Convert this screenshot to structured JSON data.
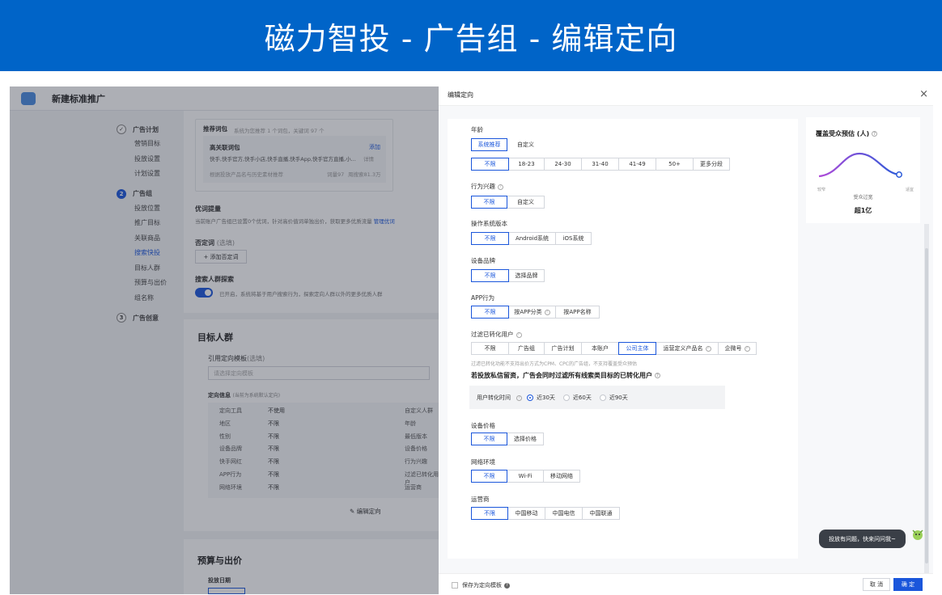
{
  "banner_title": "磁力智投 - 广告组 - 编辑定向",
  "bg": {
    "app_title": "新建标准推广",
    "steps": [
      {
        "num": "✓",
        "label": "广告计划",
        "subs": [
          "营销目标",
          "投放设置",
          "计划设置"
        ]
      },
      {
        "num": "2",
        "label": "广告组",
        "subs": [
          "投放位置",
          "推广目标",
          "关联商品",
          "搜索快投",
          "目标人群",
          "预算与出价",
          "组名称"
        ]
      },
      {
        "num": "3",
        "label": "广告创意",
        "subs": []
      }
    ],
    "recommend_title": "推荐词包",
    "recommend_note": "系统为您推荐 1 个词包，关键词 97 个",
    "pack_title": "高关联词包",
    "pack_add": "添加",
    "pack_words": "快手,快手官方,快手小店,快手直播,快手App,快手官方直播,小...",
    "pack_detail": "详情",
    "pack_note": "根据投放产品名与历史素材推荐",
    "pack_count": "词量97",
    "pack_volume": "周搜索81.3万",
    "opt_title": "优词提量",
    "opt_desc": "当前账户广告组已设置0个优词，针对高价值词单独出价，获取更多优质流量",
    "opt_link": "管理优词",
    "neg_title": "否定词",
    "neg_optional": "(选填)",
    "neg_add": "+ 添加否定词",
    "explore_title": "搜索人群探索",
    "explore_desc": "已开启，系统将基于用户搜索行为，探索定向人群以外的更多优质人群",
    "audience_title": "目标人群",
    "tpl_label": "引用定向模板",
    "tpl_optional": "(选填)",
    "tpl_placeholder": "请选择定向模板",
    "info_title": "定向信息",
    "info_note": "(当前为系统默认定向)",
    "info_rows": [
      [
        "定向工具",
        "不使用",
        "自定义人群"
      ],
      [
        "地区",
        "不限",
        "年龄"
      ],
      [
        "性别",
        "不限",
        "最低版本"
      ],
      [
        "设备品牌",
        "不限",
        "设备价格"
      ],
      [
        "快手网红",
        "不限",
        "行为兴趣"
      ],
      [
        "APP行为",
        "不限",
        "过滤已转化用户"
      ],
      [
        "网络环境",
        "不限",
        "运营商"
      ]
    ],
    "edit_targeting": "✎ 编辑定向",
    "budget_title": "预算与出价",
    "schedule_label": "投放日期"
  },
  "drawer": {
    "title": "编辑定向",
    "close": "×",
    "age": {
      "label": "年龄",
      "modes": [
        "系统推荐",
        "自定义"
      ],
      "options": [
        "不限",
        "18-23",
        "24-30",
        "31-40",
        "41-49",
        "50+",
        "更多分段"
      ]
    },
    "interest": {
      "label": "行为兴趣",
      "options": [
        "不限",
        "自定义"
      ]
    },
    "os": {
      "label": "操作系统版本",
      "options": [
        "不限",
        "Android系统",
        "iOS系统"
      ]
    },
    "brand": {
      "label": "设备品牌",
      "options": [
        "不限",
        "选择品牌"
      ]
    },
    "app": {
      "label": "APP行为",
      "options": [
        "不限",
        "按APP分类",
        "按APP名称"
      ]
    },
    "filter": {
      "label": "过滤已转化用户",
      "options": [
        "不限",
        "广告组",
        "广告计划",
        "本账户",
        "公司主体",
        "运营定义产品名",
        "企微号"
      ],
      "hint": "过滤已转化功能不支持出价方式为CPM、CPC的广告组，不支持覆盖受众预估"
    },
    "private_msg": "若投放私信留资，广告会同时过滤所有线索类目标的已转化用户",
    "convert_time": {
      "label": "用户转化时间",
      "options": [
        "近30天",
        "近60天",
        "近90天"
      ]
    },
    "price": {
      "label": "设备价格",
      "options": [
        "不限",
        "选择价格"
      ]
    },
    "network": {
      "label": "网络环境",
      "options": [
        "不限",
        "Wi-Fi",
        "移动网络"
      ]
    },
    "carrier": {
      "label": "运营商",
      "options": [
        "不限",
        "中国移动",
        "中国电信",
        "中国联通"
      ]
    },
    "coverage": {
      "title": "覆盖受众预估 (人)",
      "left": "较窄",
      "right": "适宜",
      "mid": "受众过宽",
      "value": "超1亿"
    },
    "save_template": "保存为定向模板",
    "cancel": "取 消",
    "confirm": "确 定",
    "tooltip": "投放有问题，快来问问我~"
  },
  "colors": {
    "brand": "#0064c8",
    "primary": "#1a56db",
    "curve_start": "#b04ad8",
    "curve_end": "#2b5ad8"
  }
}
